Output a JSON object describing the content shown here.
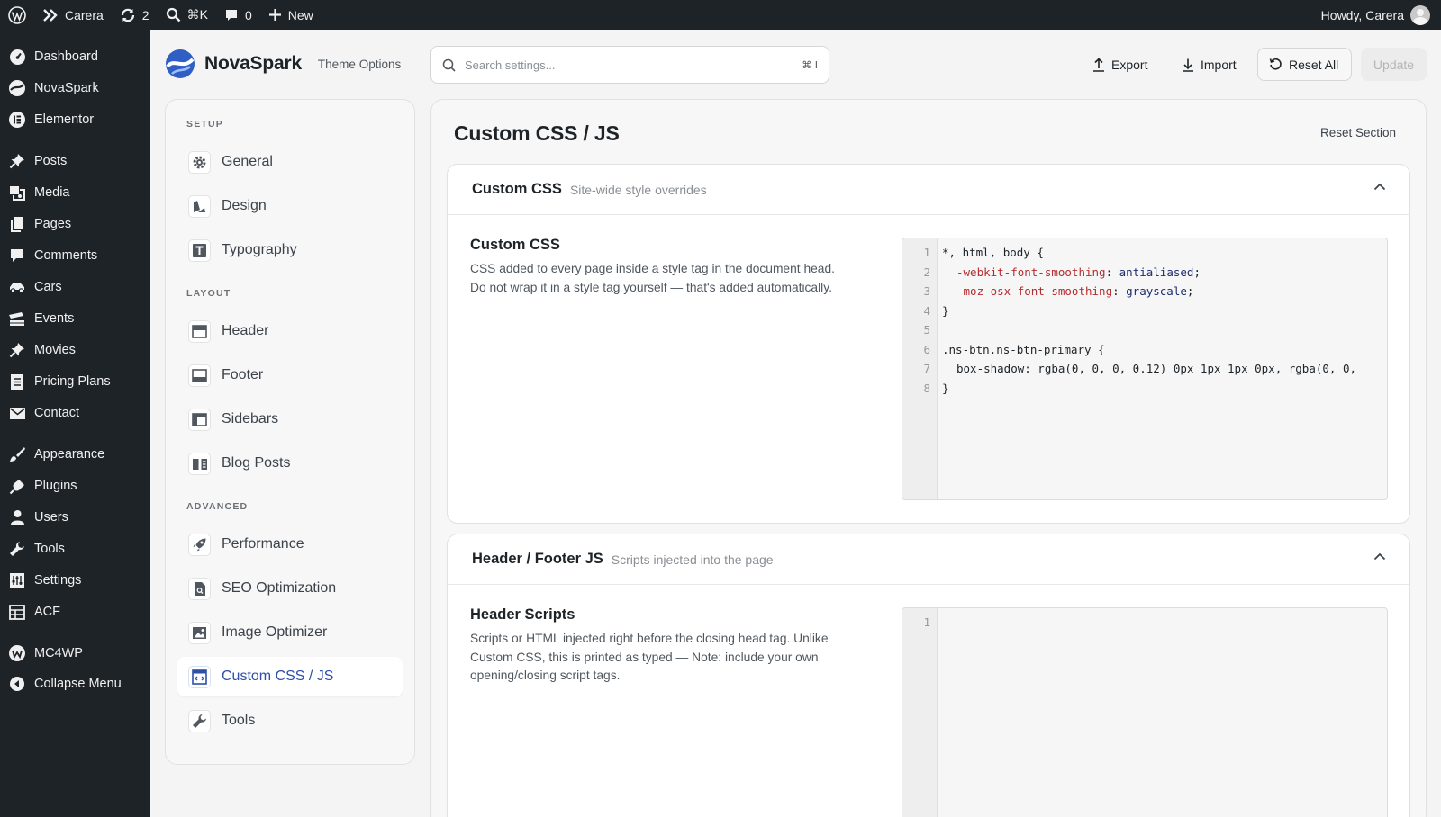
{
  "adminbar": {
    "site_name": "Carera",
    "updates_count": "2",
    "search_shortcut": "⌘K",
    "comments_count": "0",
    "new_label": "New",
    "howdy": "Howdy, Carera"
  },
  "wp_menu": {
    "items": [
      "Dashboard",
      "NovaSpark",
      "Elementor",
      "Posts",
      "Media",
      "Pages",
      "Comments",
      "Cars",
      "Events",
      "Movies",
      "Pricing Plans",
      "Contact",
      "Appearance",
      "Plugins",
      "Users",
      "Tools",
      "Settings",
      "ACF",
      "MC4WP",
      "Collapse Menu"
    ]
  },
  "header": {
    "brand": "NovaSpark",
    "subtitle": "Theme Options",
    "search_placeholder": "Search settings...",
    "search_shortcut": "⌘ I",
    "export_label": "Export",
    "import_label": "Import",
    "reset_all_label": "Reset All",
    "update_label": "Update"
  },
  "nav": {
    "sections": [
      "SETUP",
      "LAYOUT",
      "ADVANCED"
    ],
    "items": [
      "General",
      "Design",
      "Typography",
      "Header",
      "Footer",
      "Sidebars",
      "Blog Posts",
      "Performance",
      "SEO Optimization",
      "Image Optimizer",
      "Custom CSS / JS",
      "Tools"
    ],
    "active": "Custom CSS / JS"
  },
  "main": {
    "title": "Custom CSS / JS",
    "reset_section": "Reset Section",
    "cards": [
      {
        "title": "Custom CSS",
        "subtitle": "Site-wide style overrides",
        "field_title": "Custom CSS",
        "field_desc": "CSS added to every page inside a style tag in the document head. Do not wrap it in a style tag yourself — that's added automatically.",
        "line_numbers": [
          "1",
          "2",
          "3",
          "4",
          "5",
          "6",
          "7",
          "8"
        ],
        "code": {
          "l1": "*, html, body {",
          "l2_prop": "-webkit-font-smoothing",
          "l2_val": "antialiased",
          "l3_prop": "-moz-osx-font-smoothing",
          "l3_val": "grayscale",
          "l4": "}",
          "l6": ".ns-btn.ns-btn-primary {",
          "l7": "box-shadow: rgba(0, 0, 0, 0.12) 0px 1px 1px 0px, rgba(0, 0,",
          "l8": "}"
        }
      },
      {
        "title": "Header / Footer JS",
        "subtitle": "Scripts injected into the page",
        "field_title": "Header Scripts",
        "field_desc": "Scripts or HTML injected right before the closing head tag. Unlike Custom CSS, this is printed as typed — Note: include your own opening/closing script tags.",
        "line_numbers": [
          "1"
        ]
      }
    ]
  },
  "colors": {
    "admin_dark": "#1d2327",
    "accent": "#2f4fa8"
  }
}
